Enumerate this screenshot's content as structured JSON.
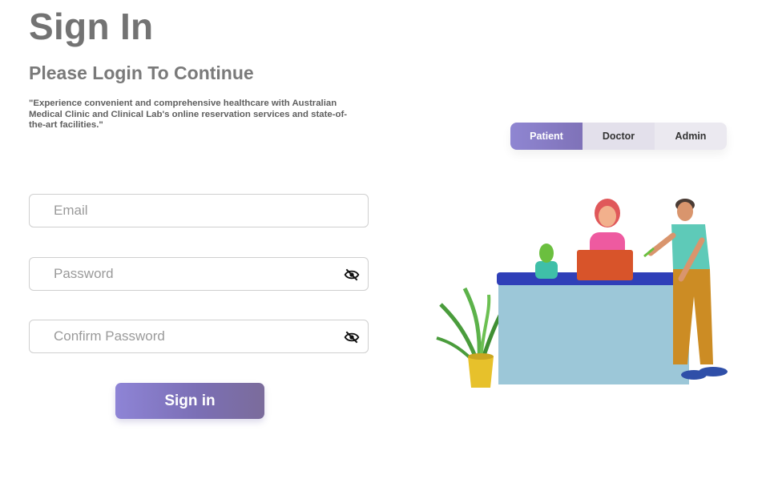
{
  "page": {
    "title": "Sign In",
    "subtitle": "Please Login To Continue",
    "quote": "\"Experience convenient and comprehensive healthcare with Australian Medical Clinic and Clinical Lab's online reservation services and state-of-the-art facilities.\""
  },
  "form": {
    "email_placeholder": "Email",
    "email_value": "",
    "password_placeholder": "Password",
    "password_value": "",
    "confirm_placeholder": "Confirm Password",
    "confirm_value": "",
    "submit_label": "Sign in"
  },
  "roles": {
    "selected": "Patient",
    "items": [
      {
        "label": "Patient"
      },
      {
        "label": "Doctor"
      },
      {
        "label": "Admin"
      }
    ]
  },
  "icons": {
    "password_toggle": "eye-off-icon",
    "confirm_toggle": "eye-off-icon"
  },
  "colors": {
    "accent_start": "#8e84d6",
    "accent_end": "#7b6c9b",
    "desk_top": "#2f3fb8",
    "desk_body": "#9cc7d8"
  }
}
